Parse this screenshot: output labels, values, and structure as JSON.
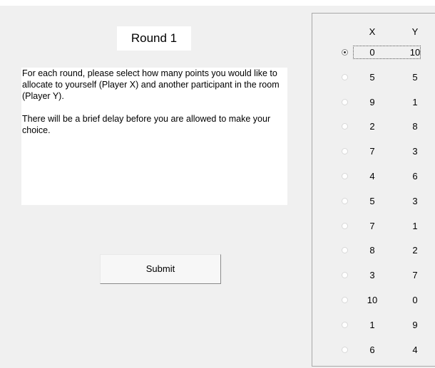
{
  "round": {
    "title": "Round 1"
  },
  "instructions": {
    "paragraph1": "For each round, please select how many points you would like to allocate to yourself (Player X) and another participant in the room (Player Y).",
    "paragraph2": "There will be a brief delay before you are allowed to make your choice."
  },
  "submit": {
    "label": "Submit"
  },
  "choices": {
    "header_x": "X",
    "header_y": "Y",
    "selected_index": 0,
    "options": [
      {
        "x": "0",
        "y": "10"
      },
      {
        "x": "5",
        "y": "5"
      },
      {
        "x": "9",
        "y": "1"
      },
      {
        "x": "2",
        "y": "8"
      },
      {
        "x": "7",
        "y": "3"
      },
      {
        "x": "4",
        "y": "6"
      },
      {
        "x": "5",
        "y": "3"
      },
      {
        "x": "7",
        "y": "1"
      },
      {
        "x": "8",
        "y": "2"
      },
      {
        "x": "3",
        "y": "7"
      },
      {
        "x": "10",
        "y": "0"
      },
      {
        "x": "1",
        "y": "9"
      },
      {
        "x": "6",
        "y": "4"
      }
    ]
  }
}
